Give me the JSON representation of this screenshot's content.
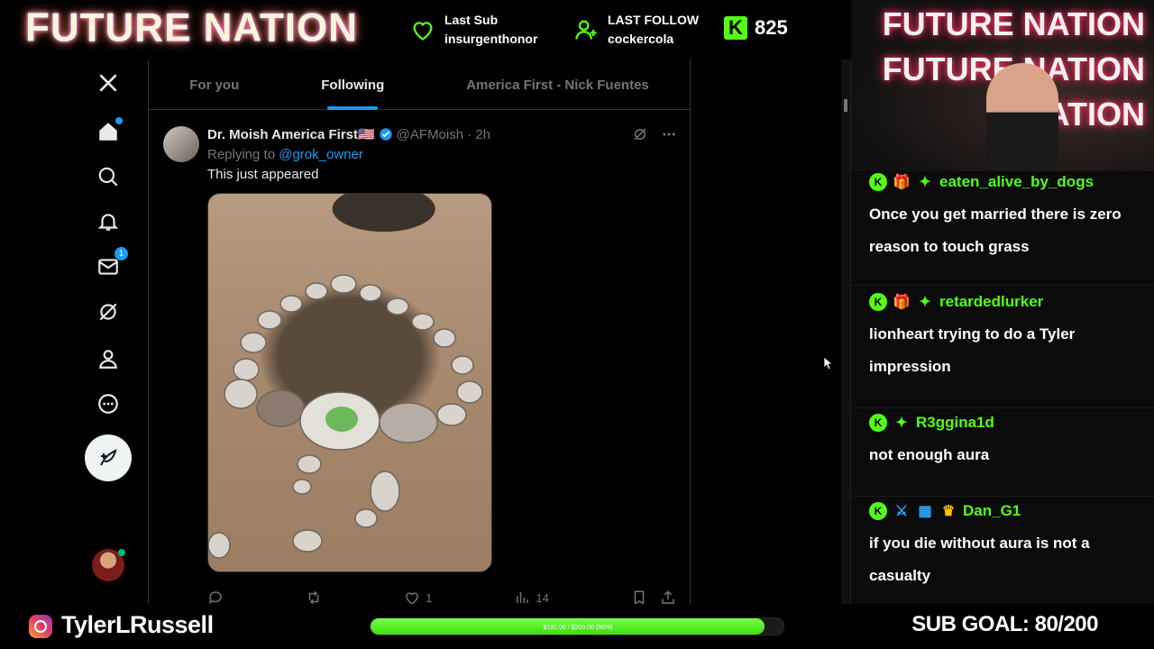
{
  "overlay": {
    "brand": "FUTURE NATION",
    "last_sub_label": "Last Sub",
    "last_sub_user": "insurgenthonor",
    "last_follow_label": "LAST FOLLOW",
    "last_follow_user": "cockercola",
    "kick_logo": "K",
    "kick_count": "825",
    "cam_neon": [
      "FUTURE NATION",
      "FUTURE NATION",
      "NATION"
    ],
    "instagram_handle": "TylerLRussell",
    "goal_text": "$191.00 / $200.00 (96%)",
    "goal_progress": 0.955,
    "sub_goal": "SUB GOAL: 80/200"
  },
  "x": {
    "tabs": [
      {
        "label": "For you",
        "active": false
      },
      {
        "label": "Following",
        "active": true
      },
      {
        "label": "America First - Nick Fuentes",
        "active": false
      }
    ],
    "nav_icons": [
      "x-logo-icon",
      "home-icon",
      "search-icon",
      "notifications-icon",
      "messages-icon",
      "grok-icon",
      "profile-icon",
      "more-icon"
    ],
    "messages_badge": "1",
    "tweet": {
      "name": "Dr. Moish America First🇺🇸",
      "handle": "@AFMoish",
      "time": "· 2h",
      "replying_prefix": "Replying to",
      "replying_to": "@grok_owner",
      "text": "This just appeared",
      "likes": "1",
      "views": "14"
    }
  },
  "chat": [
    {
      "user": "eaten_alive_by_dogs",
      "badges": [
        "k",
        "gift",
        "sub"
      ],
      "text": "Once you get married there is zero reason to touch grass"
    },
    {
      "user": "retardedlurker",
      "badges": [
        "k",
        "gift",
        "sub"
      ],
      "text": "lionheart trying to do a Tyler impression"
    },
    {
      "user": "R3ggina1d",
      "badges": [
        "k",
        "sub"
      ],
      "text": "not enough aura"
    },
    {
      "user": "Dan_G1",
      "badges": [
        "k",
        "sword",
        "grid",
        "crown"
      ],
      "text": "if you die without aura is not a casualty"
    }
  ],
  "colors": {
    "kick_green": "#53fc18",
    "x_blue": "#1d9bf0",
    "x_muted": "#71767b"
  }
}
